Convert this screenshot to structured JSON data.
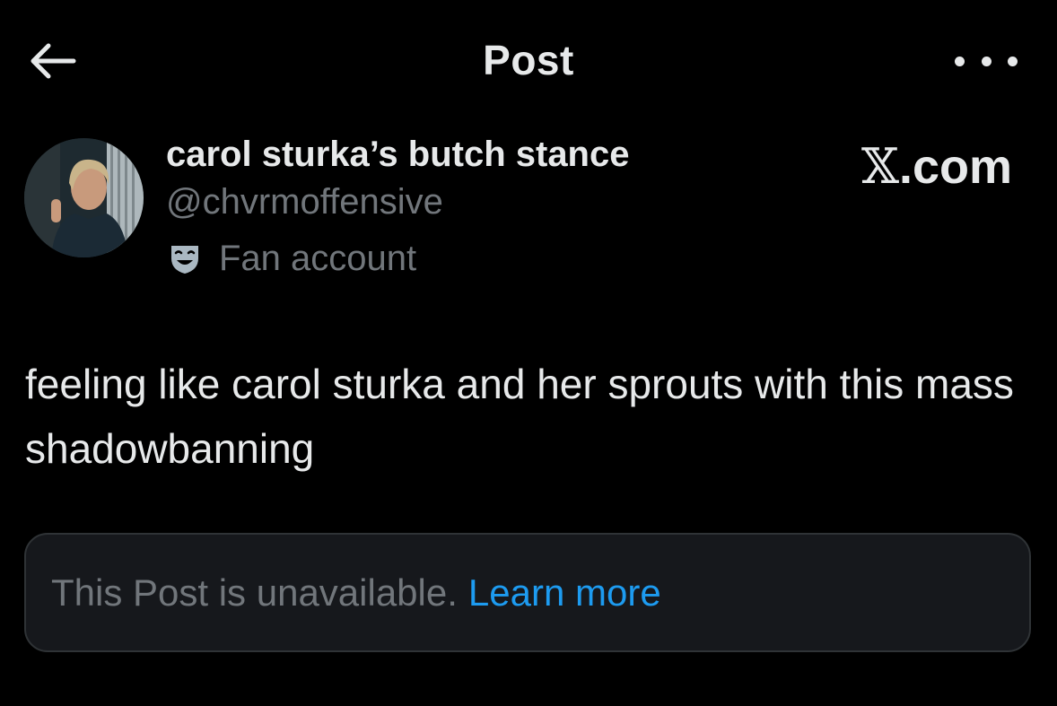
{
  "header": {
    "title": "Post",
    "back_icon": "arrow-left-icon",
    "more_icon": "more-horizontal-icon"
  },
  "author": {
    "display_name": "carol sturka’s butch stance",
    "handle": "@chvrmoffensive",
    "badge_icon": "theater-mask-icon",
    "badge_label": "Fan account"
  },
  "watermark": {
    "x_char": "𝕏",
    "suffix": ".com"
  },
  "tweet": {
    "text": "feeling like carol sturka and her sprouts with this mass shadowbanning"
  },
  "quoted_post": {
    "message": "This Post is unavailable.",
    "link_label": "Learn more"
  },
  "colors": {
    "background": "#000000",
    "text_primary": "#e7e9ea",
    "text_secondary": "#71767b",
    "link": "#1d9bf0",
    "card_bg": "#16181c",
    "card_border": "#2f3336"
  }
}
